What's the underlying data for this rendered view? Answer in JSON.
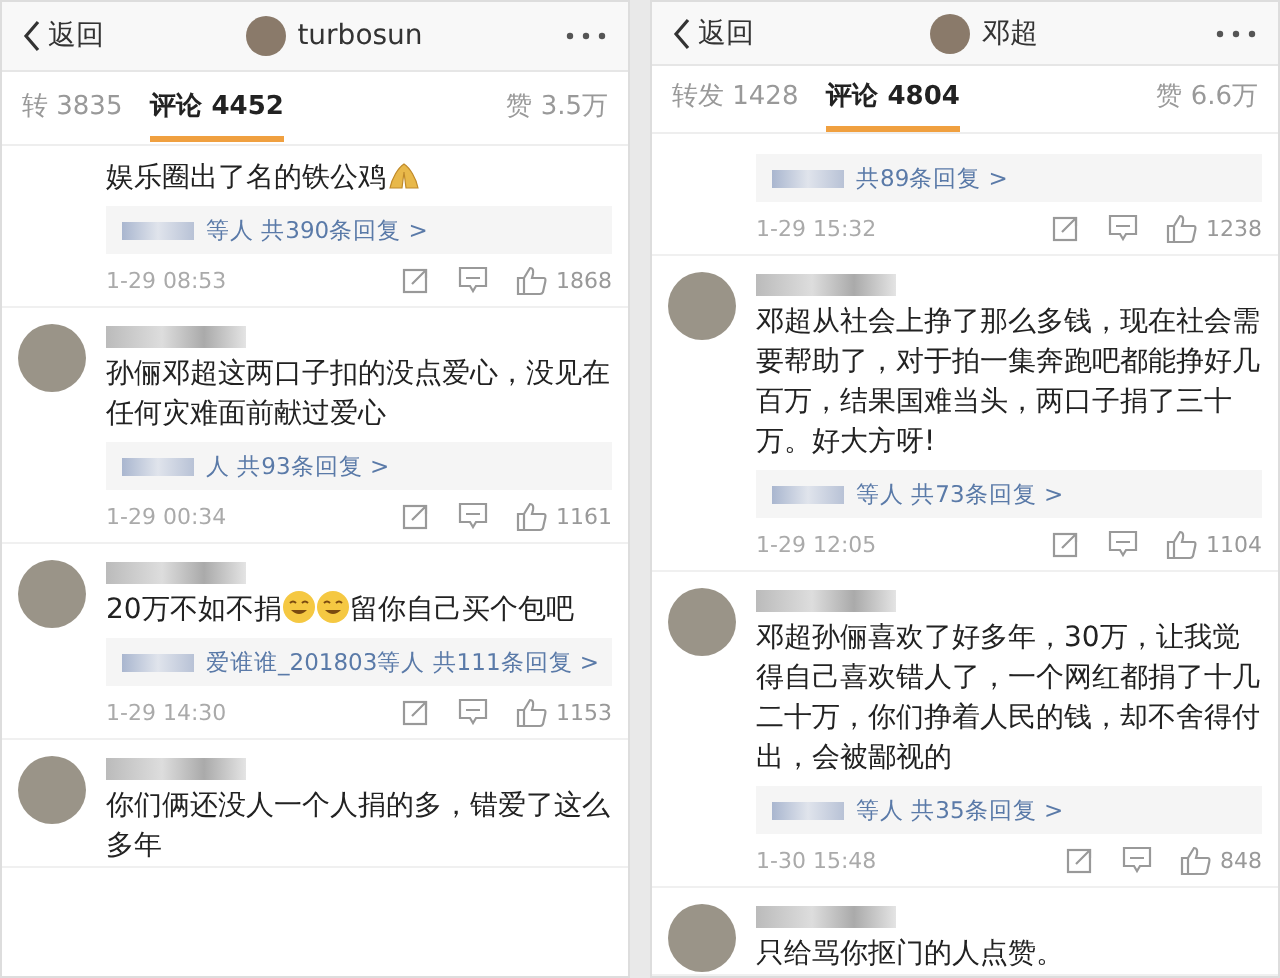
{
  "panels": [
    {
      "header": {
        "back": "返回",
        "name": "turbosun"
      },
      "tabs": [
        {
          "label": "转",
          "count": "3835",
          "selected": false
        },
        {
          "label": "评论",
          "count": "4452",
          "selected": true
        }
      ],
      "likes": {
        "label": "赞",
        "count": "3.5万"
      },
      "comments": [
        {
          "author_visible": false,
          "body": [
            {
              "kind": "text",
              "text": "娱乐圈出了名的铁公鸡"
            },
            {
              "kind": "hands"
            }
          ],
          "replies": "等人 共390条回复 >",
          "time": "1-29 08:53",
          "likes": "1868"
        },
        {
          "author_visible": true,
          "body": [
            {
              "kind": "text",
              "text": "孙俪邓超这两口子扣的没点爱心，没见在任何灾难面前献过爱心"
            }
          ],
          "replies": "人 共93条回复 >",
          "time": "1-29 00:34",
          "likes": "1161"
        },
        {
          "author_visible": true,
          "body": [
            {
              "kind": "text",
              "text": "20万不如不捐"
            },
            {
              "kind": "smiley"
            },
            {
              "kind": "smiley"
            },
            {
              "kind": "text",
              "text": "留你自己买个包吧"
            }
          ],
          "replies": "爱谁谁_201803等人 共111条回复 >",
          "time": "1-29 14:30",
          "likes": "1153"
        },
        {
          "author_visible": true,
          "body": [
            {
              "kind": "text",
              "text": "你们俩还没人一个人捐的多，错爱了这么多年"
            }
          ]
        }
      ]
    },
    {
      "header": {
        "back": "返回",
        "name": "邓超"
      },
      "tabs": [
        {
          "label": "转发",
          "count": "1428",
          "selected": false
        },
        {
          "label": "评论",
          "count": "4804",
          "selected": true
        }
      ],
      "likes": {
        "label": "赞",
        "count": "6.6万"
      },
      "comments": [
        {
          "author_visible": false,
          "replies": "共89条回复 >",
          "time": "1-29 15:32",
          "likes": "1238"
        },
        {
          "author_visible": true,
          "body": [
            {
              "kind": "text",
              "text": "邓超从社会上挣了那么多钱，现在社会需要帮助了，对于拍一集奔跑吧都能挣好几百万，结果国难当头，两口子捐了三十万。好大方呀!"
            }
          ],
          "replies": "等人 共73条回复 >",
          "time": "1-29 12:05",
          "likes": "1104"
        },
        {
          "author_visible": true,
          "body": [
            {
              "kind": "text",
              "text": "邓超孙俪喜欢了好多年，30万，让我觉得自己喜欢错人了，一个网红都捐了十几二十万，你们挣着人民的钱，却不舍得付出，会被鄙视的"
            }
          ],
          "replies": "等人 共35条回复 >",
          "time": "1-30 15:48",
          "likes": "848"
        },
        {
          "author_visible": true,
          "body": [
            {
              "kind": "text",
              "text": "只给骂你抠门的人点赞。"
            }
          ]
        }
      ]
    }
  ]
}
